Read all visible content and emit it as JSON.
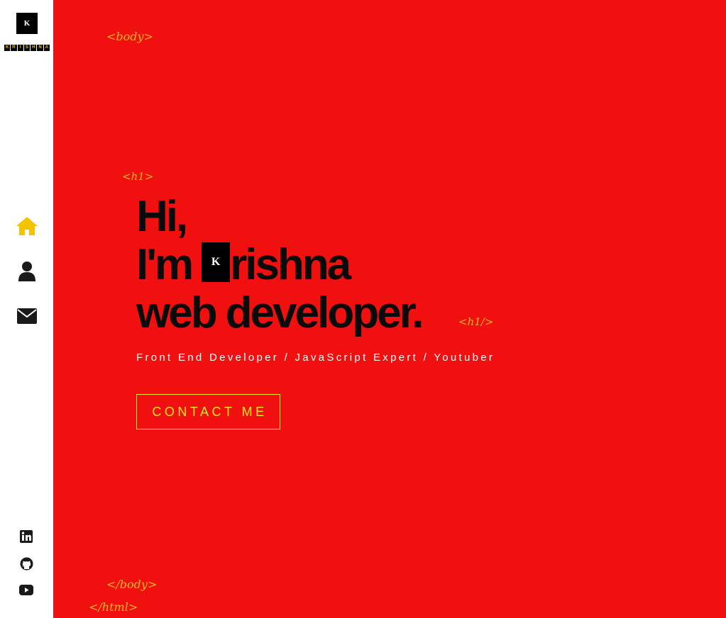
{
  "brand": {
    "logo_letter": "K",
    "wordmark_letters": [
      "K",
      "R",
      "I",
      "S",
      "H",
      "N",
      "A"
    ]
  },
  "sidebar": {
    "nav": [
      {
        "name": "home",
        "icon": "home-icon",
        "active": true
      },
      {
        "name": "about",
        "icon": "user-icon",
        "active": false
      },
      {
        "name": "contact",
        "icon": "envelope-icon",
        "active": false
      }
    ],
    "social": [
      {
        "name": "linkedin",
        "icon": "linkedin-icon"
      },
      {
        "name": "github",
        "icon": "github-icon"
      },
      {
        "name": "youtube",
        "icon": "youtube-icon"
      }
    ]
  },
  "main": {
    "tags": {
      "body_open": "<body>",
      "h1_open": "<h1>",
      "h1_close": "<h1/>",
      "body_close": "</body>",
      "html_close": "</html>"
    },
    "heading": {
      "line1": "Hi,",
      "line2_prefix": "I'm",
      "line2_logo": "K",
      "line2_suffix": "rishna",
      "line3": "web developer."
    },
    "subtitle": "Front End Developer / JavaScript Expert / Youtuber",
    "contact_button": "CONTACT ME"
  },
  "colors": {
    "main_background": "#f01010",
    "sidebar_background": "#ffffff",
    "accent_yellow": "#f5e51b",
    "tag_color": "#f7b52a",
    "active_icon": "#f5c400",
    "icon_default": "#1a1a1a",
    "heading_text": "#0a0a0a"
  }
}
